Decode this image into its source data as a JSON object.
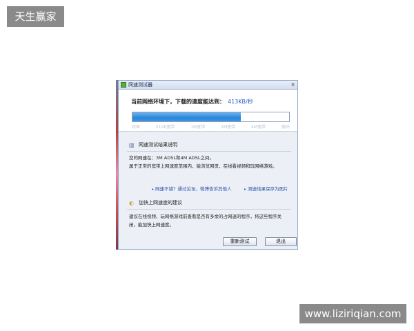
{
  "watermarks": {
    "top_left": "天生赢家",
    "bottom_right": "www.liziriqian.com"
  },
  "window": {
    "title": "网速测试器",
    "close_glyph": "×"
  },
  "speed": {
    "label": "当前网络环境下，下载的速度能达到：",
    "value": "413KB/秒",
    "progress_fraction": 0.69,
    "progress_color": "#2a86d8",
    "ticks": [
      "较差",
      "512K宽带",
      "1M宽带",
      "2M宽带",
      "4M宽带",
      "很好"
    ]
  },
  "result_section": {
    "icon": "chart-icon",
    "title": "网速测试结果说明",
    "line1": "您的网速在：3M ADSL和4M ADSL之间。",
    "line2": "属于正常的宽带上网速度范围内，能浏览网页，在线看视频和玩网络游戏。"
  },
  "links": {
    "feedback": "网速不错？通过论坛、微博告诉其他人",
    "save_image": "测速结果保存为图片"
  },
  "suggest_section": {
    "icon": "lightbulb-icon",
    "title": "加快上网速度的建议",
    "line1": "建议在线视频、玩网络游戏前查看是否有多余的占网速的程序，将这些程序关",
    "line2": "闭，能加快上网速度。"
  },
  "buttons": {
    "retest": "重新测试",
    "exit": "退出"
  },
  "colors": {
    "link": "#2a52a8",
    "accent": "#2a86d8",
    "speed_value": "#2a56c6"
  }
}
